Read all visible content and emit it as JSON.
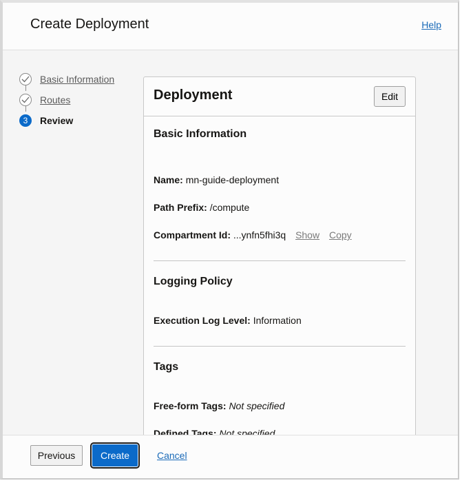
{
  "header": {
    "title": "Create Deployment",
    "help_label": "Help"
  },
  "steps": [
    {
      "label": "Basic Information",
      "state": "completed",
      "icon": "check-circle-icon"
    },
    {
      "label": "Routes",
      "state": "completed",
      "icon": "check-circle-icon"
    },
    {
      "label": "Review",
      "state": "current",
      "number": "3"
    }
  ],
  "card": {
    "title": "Deployment",
    "edit_label": "Edit",
    "basic": {
      "title": "Basic Information",
      "name_label": "Name:",
      "name_value": "mn-guide-deployment",
      "path_label": "Path Prefix:",
      "path_value": "/compute",
      "compartment_label": "Compartment Id:",
      "compartment_value": "...ynfn5fhi3q",
      "show_label": "Show",
      "copy_label": "Copy"
    },
    "logging": {
      "title": "Logging Policy",
      "level_label": "Execution Log Level:",
      "level_value": "Information"
    },
    "tags": {
      "title": "Tags",
      "freeform_label": "Free-form Tags:",
      "freeform_value": "Not specified",
      "defined_label": "Defined Tags:",
      "defined_value": "Not specified"
    }
  },
  "footer": {
    "previous_label": "Previous",
    "create_label": "Create",
    "cancel_label": "Cancel"
  },
  "colors": {
    "accent": "#0b6ac9",
    "link": "#1a6ab8",
    "background": "#f5f5f5"
  }
}
